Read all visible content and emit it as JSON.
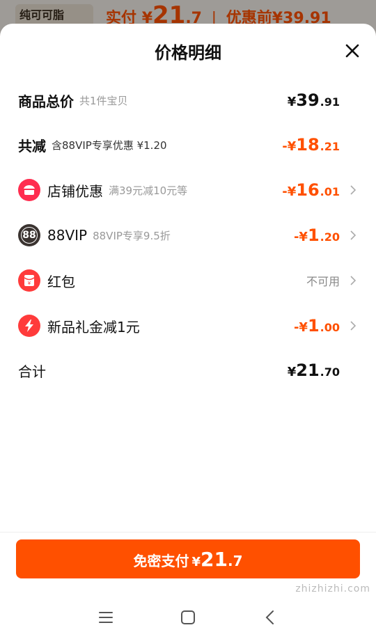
{
  "background": {
    "thumb_text": "纯可可脂",
    "price_prefix": "实付",
    "price_symbol": "¥",
    "price_int": "21",
    "price_dec": ".7",
    "before_text": "优惠前¥39.91"
  },
  "sheet": {
    "title": "价格明细"
  },
  "rows": {
    "total": {
      "label": "商品总价",
      "sub": "共1件宝贝",
      "sym": "¥",
      "int": "39",
      "dec": ".91"
    },
    "reduce": {
      "label": "共减",
      "sub": "含88VIP专享优惠 ¥1.20",
      "sym": "-¥",
      "int": "18",
      "dec": ".21"
    },
    "shop": {
      "label": "店铺优惠",
      "sub": "满39元减10元等",
      "sym": "-¥",
      "int": "16",
      "dec": ".01",
      "icon": "shop-icon"
    },
    "vip": {
      "label": "88VIP",
      "sub": "88VIP专享9.5折",
      "sym": "-¥",
      "int": "1",
      "dec": ".20",
      "icon_text": "88",
      "icon": "vip88-icon"
    },
    "redpacket": {
      "label": "红包",
      "status": "不可用",
      "icon": "red-packet-icon"
    },
    "newgift": {
      "label": "新品礼金减1元",
      "sym": "-¥",
      "int": "1",
      "dec": ".00",
      "icon": "lightning-icon"
    },
    "sum": {
      "label": "合计",
      "sym": "¥",
      "int": "21",
      "dec": ".70"
    }
  },
  "pay_button": {
    "label": "免密支付",
    "sym": "¥",
    "int": "21",
    "dec": ".7"
  },
  "watermark": "zhizhizhi.com",
  "colors": {
    "accent": "#ff5000",
    "shop_icon_bg": "#ff2d4f",
    "vip_icon_bg": "#3a3330",
    "redpacket_icon_bg": "#ff3b3b"
  }
}
